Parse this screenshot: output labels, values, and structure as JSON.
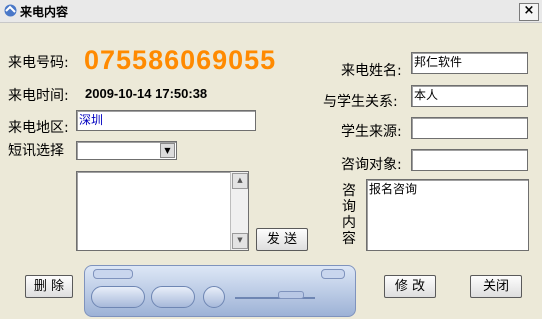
{
  "window": {
    "title": "来电内容",
    "close_glyph": "×"
  },
  "caller": {
    "number_label": "来电号码:",
    "number": "075586069055",
    "time_label": "来电时间:",
    "time": "2009-10-14 17:50:38",
    "region_label": "来电地区:",
    "region": "深圳",
    "sms_label": "短讯选择",
    "sms_selected": ""
  },
  "right": {
    "name_label": "来电姓名:",
    "name": "邦仁软件",
    "relation_label": "与学生关系:",
    "relation": "本人",
    "source_label": "学生来源:",
    "source": "",
    "target_label": "咨询对象:",
    "target": "",
    "content_label": "咨询内容",
    "content": "报名咨询"
  },
  "buttons": {
    "send": "发 送",
    "delete": "删 除",
    "modify": "修 改",
    "close": "关闭"
  },
  "sms_text": ""
}
